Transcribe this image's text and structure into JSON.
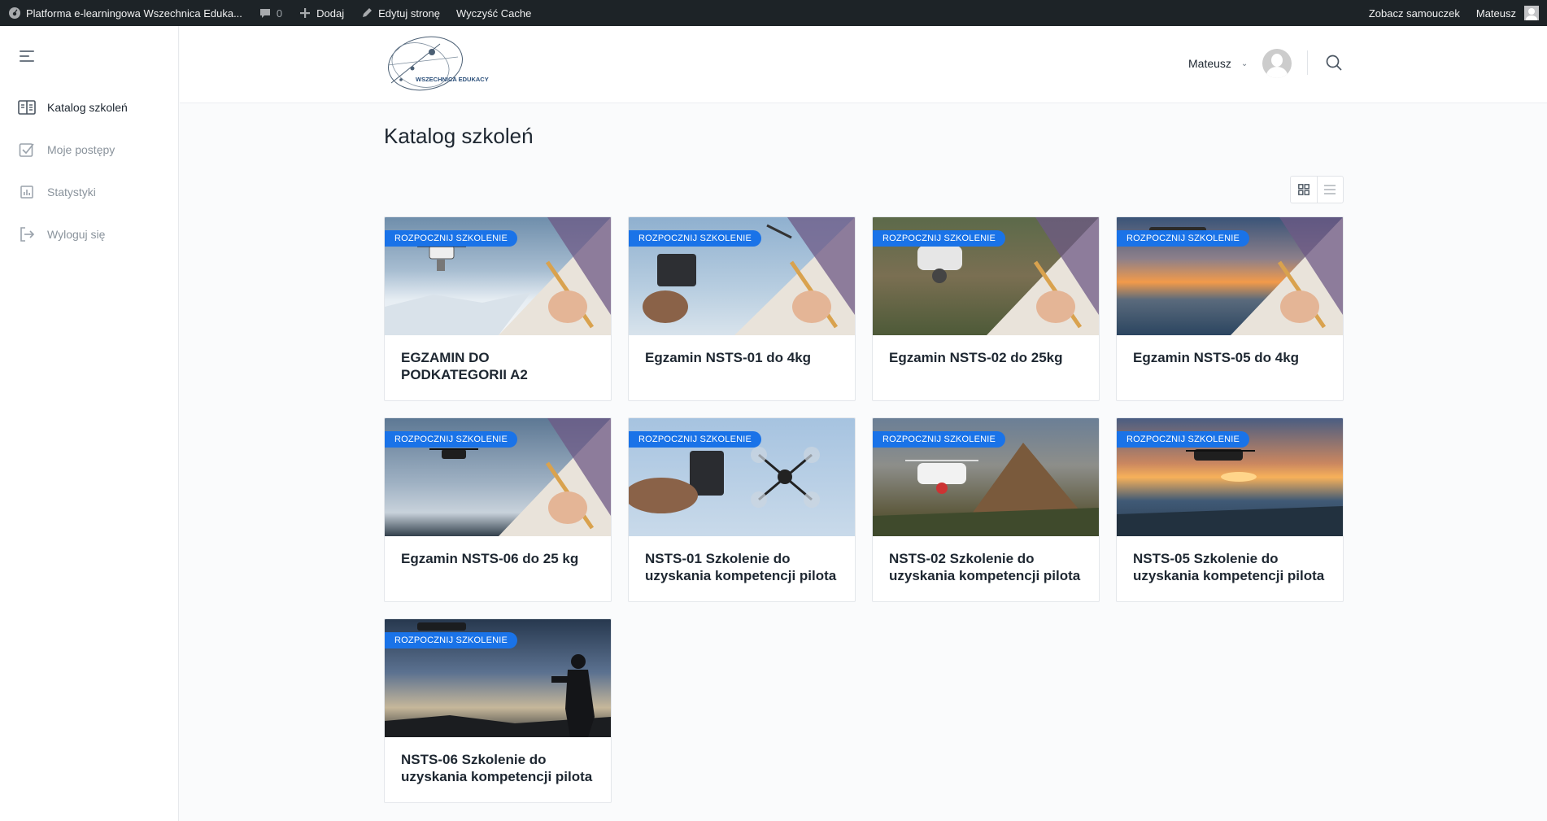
{
  "adminbar": {
    "site_name": "Platforma e-learningowa Wszechnica Eduka...",
    "comments_count": "0",
    "add_label": "Dodaj",
    "edit_label": "Edytuj stronę",
    "cache_label": "Wyczyść Cache",
    "tutorial_label": "Zobacz samouczek",
    "user_label": "Mateusz"
  },
  "sidebar": {
    "items": [
      {
        "label": "Katalog szkoleń",
        "icon": "book-icon",
        "active": true
      },
      {
        "label": "Moje postępy",
        "icon": "checkbox-icon",
        "active": false
      },
      {
        "label": "Statystyki",
        "icon": "chart-icon",
        "active": false
      },
      {
        "label": "Wyloguj się",
        "icon": "logout-icon",
        "active": false
      }
    ]
  },
  "header": {
    "logo_text": "WSZECHNICA EDUKACYJNA",
    "user_name": "Mateusz"
  },
  "main": {
    "title": "Katalog szkoleń",
    "badge_label": "ROZPOCZNIJ SZKOLENIE",
    "courses": [
      {
        "title": "EGZAMIN DO PODKATEGORII A2"
      },
      {
        "title": "Egzamin NSTS-01 do 4kg"
      },
      {
        "title": "Egzamin NSTS-02 do 25kg"
      },
      {
        "title": "Egzamin NSTS-05 do 4kg"
      },
      {
        "title": "Egzamin NSTS-06 do 25 kg"
      },
      {
        "title": "NSTS-01 Szkolenie do uzyskania kompetencji pilota"
      },
      {
        "title": "NSTS-02 Szkolenie do uzyskania kompetencji pilota"
      },
      {
        "title": "NSTS-05 Szkolenie do uzyskania kompetencji pilota"
      },
      {
        "title": "NSTS-06 Szkolenie do uzyskania kompetencji pilota"
      }
    ]
  },
  "colors": {
    "adminbar_bg": "#1d2327",
    "badge_bg": "#1a73e8",
    "text_primary": "#1e2731",
    "text_muted": "#8a939c"
  }
}
